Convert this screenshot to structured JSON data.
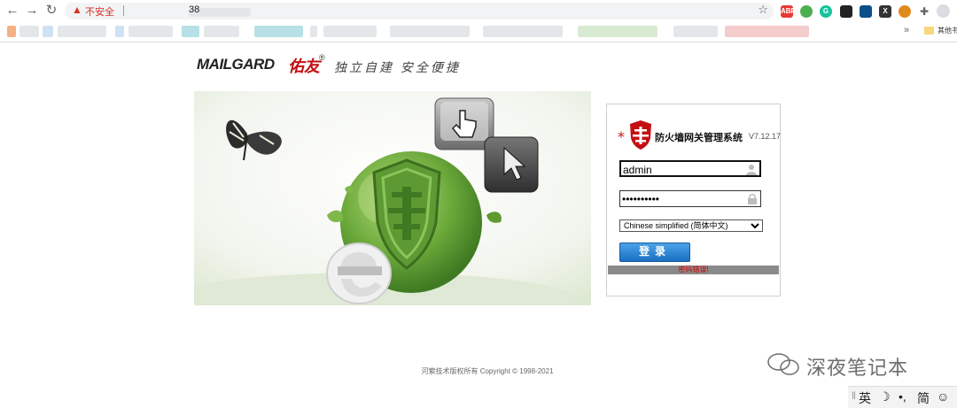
{
  "browser": {
    "security_label": "不安全",
    "url": "38",
    "bookmarks_more": "»",
    "bookmarks_other": "其他书"
  },
  "header": {
    "logo_wordmark": "MAILGARD",
    "logo_cn": "佑友",
    "logo_reg": "®",
    "slogan": "独立自建 安全便捷"
  },
  "login": {
    "system_title": "防火墙网关管理系统",
    "version": "V7.12.17",
    "username_value": "admin",
    "password_value": "••••••••••",
    "language_options": [
      "Chinese simplified (简体中文)"
    ],
    "login_label": "登录",
    "error_text": "密码错误!"
  },
  "footer": {
    "copyright": "河萦技术版权所有 Copyright © 1998-2021"
  },
  "watermark": {
    "text": "深夜笔记本"
  },
  "ime": {
    "lang": "英",
    "mode": "简"
  },
  "colors": {
    "brand_red": "#c40f12",
    "button_blue": "#1a6fc2",
    "banner_green": "#6aa83a"
  }
}
